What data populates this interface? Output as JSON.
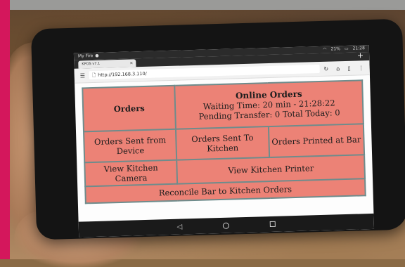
{
  "status_bar": {
    "carrier": "My Fire",
    "battery": "21%",
    "time": "21:28"
  },
  "browser": {
    "tab_title": "KPOS v7.1",
    "tab_close": "×",
    "new_tab": "+",
    "url": "http://192.168.3.110/",
    "icons": [
      "menu-icon",
      "lock-icon",
      "reload-icon",
      "home-icon",
      "bookmark-icon",
      "more-icon"
    ]
  },
  "pos": {
    "orders_label": "Orders",
    "online_title": "Online Orders",
    "waiting_time": "Waiting Time: 20 min - 21:28:22",
    "pending": "Pending Transfer: 0 Total Today: 0",
    "sent_from_device": "Orders Sent from Device",
    "sent_to_kitchen": "Orders Sent To Kitchen",
    "printed_at_bar": "Orders Printed at Bar",
    "view_camera": "View Kitchen Camera",
    "view_printer": "View Kitchen Printer",
    "reconcile": "Reconcile Bar to Kitchen Orders"
  },
  "colors": {
    "cell_background": "#ec8276",
    "cell_border": "#6e8c8c",
    "accent_bar": "#d4175c"
  }
}
